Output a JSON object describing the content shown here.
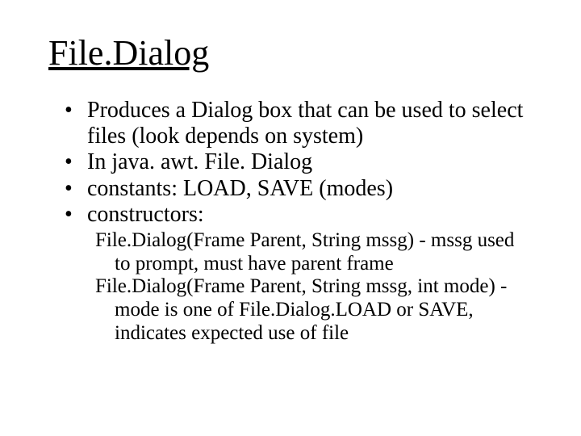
{
  "title": "File.Dialog",
  "bullets": [
    "Produces a Dialog box that can be used to select files (look depends on system)",
    "In java. awt. File. Dialog",
    "constants: LOAD, SAVE (modes)",
    "constructors:"
  ],
  "sub": [
    "File.Dialog(Frame Parent, String mssg) - mssg used to prompt, must have parent frame",
    "File.Dialog(Frame Parent, String mssg, int mode) - mode is one of File.Dialog.LOAD or SAVE, indicates expected use of file"
  ]
}
